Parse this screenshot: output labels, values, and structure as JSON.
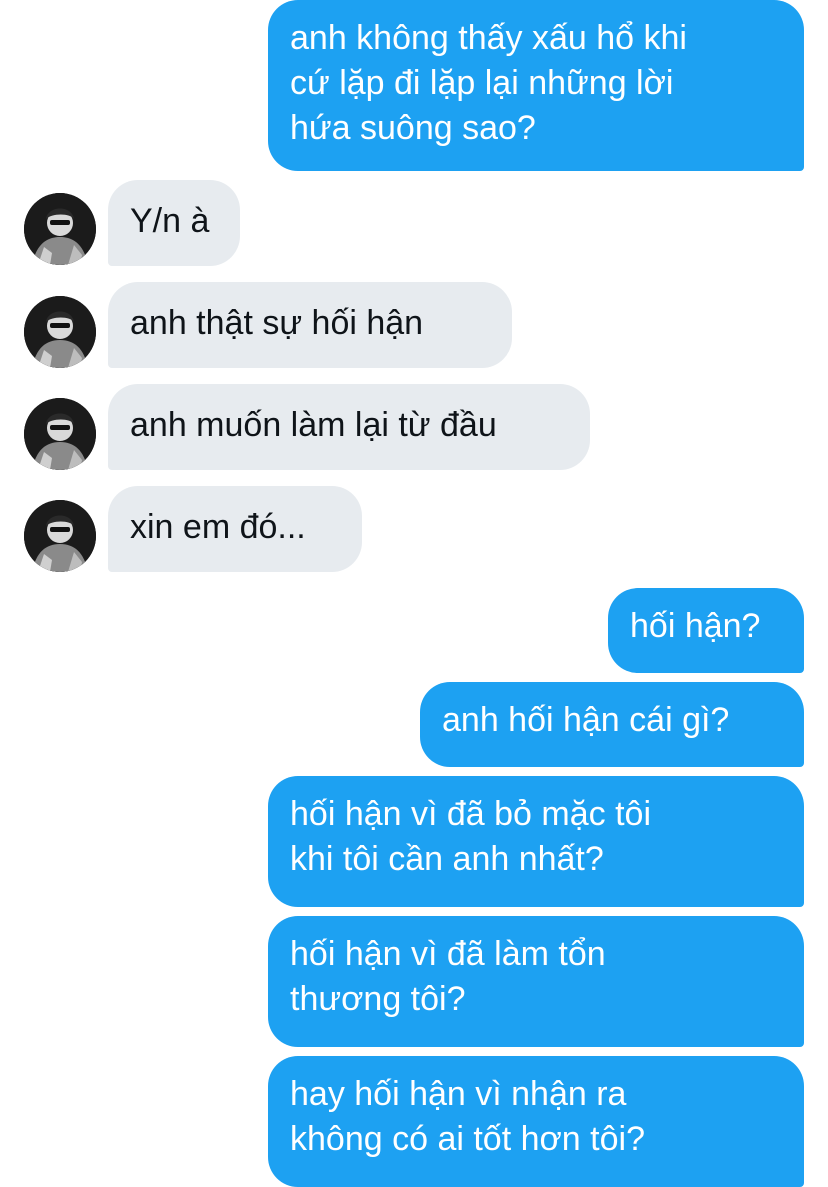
{
  "conversation": {
    "messages": [
      {
        "side": "out",
        "lines": [
          "anh không thấy xấu hổ khi",
          "cứ lặp đi lặp lại những lời",
          "hứa suông sao?"
        ]
      },
      {
        "side": "in",
        "lines": [
          "Y/n à"
        ]
      },
      {
        "side": "in",
        "lines": [
          "anh thật sự hối hận"
        ]
      },
      {
        "side": "in",
        "lines": [
          "anh muốn làm lại từ đầu"
        ]
      },
      {
        "side": "in",
        "lines": [
          "xin em đó..."
        ]
      },
      {
        "side": "out",
        "lines": [
          "hối hận?"
        ]
      },
      {
        "side": "out",
        "lines": [
          "anh hối hận cái gì?"
        ]
      },
      {
        "side": "out",
        "lines": [
          "hối hận vì đã bỏ mặc tôi",
          "khi tôi cần anh nhất?"
        ]
      },
      {
        "side": "out",
        "lines": [
          "hối hận vì đã làm tổn",
          "thương tôi?"
        ]
      },
      {
        "side": "out",
        "lines": [
          "hay hối hận vì nhận ra",
          "không có ai tốt hơn tôi?"
        ]
      }
    ]
  },
  "colors": {
    "outgoing_bubble": "#1da1f2",
    "incoming_bubble": "#e7ebef",
    "outgoing_text": "#ffffff",
    "incoming_text": "#0f1419"
  },
  "icons": {
    "avatar": "profile-photo-person-sunglasses"
  }
}
